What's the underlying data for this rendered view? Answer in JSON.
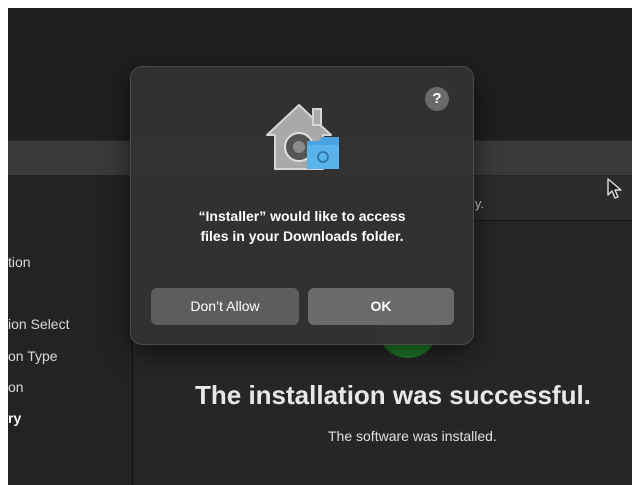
{
  "installer": {
    "sidebar": {
      "items": [
        {
          "label": "tion"
        },
        {
          "label": "ion Select"
        },
        {
          "label": "on Type"
        },
        {
          "label": "on"
        },
        {
          "label": "ry"
        }
      ]
    },
    "pane_header_text": "ly.",
    "success_title": "The installation was successful.",
    "success_subtitle": "The software was installed."
  },
  "dialog": {
    "help_label": "?",
    "message_line1": "“Installer” would like to access",
    "message_line2": "files in your Downloads folder.",
    "deny_label": "Don’t Allow",
    "ok_label": "OK",
    "icon": "house-folder-icon"
  },
  "colors": {
    "success_green": "#1f8a2e",
    "folder_blue": "#4aa3e0"
  }
}
